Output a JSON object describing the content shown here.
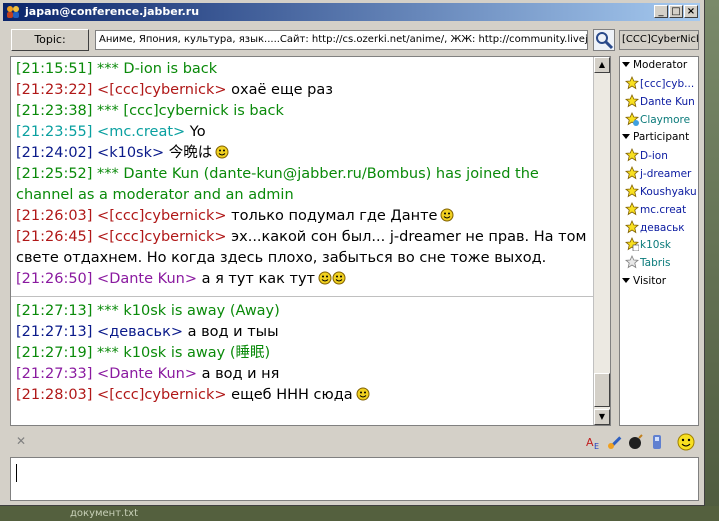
{
  "window": {
    "title": "japan@conference.jabber.ru"
  },
  "topic": {
    "button_label": "Topic:",
    "text": "Аниме, Япония, культура, язык.....Сайт: http://cs.ozerki.net/anime/, ЖЖ: http://community.livejournal"
  },
  "my_nick": "[CCC]CyberNick",
  "colors": {
    "green": "#0a8a0a",
    "red": "#b01818",
    "blue": "#0a1a8a",
    "teal": "#0aa0a0",
    "purple": "#8a1aa0",
    "accent": "#0a246a"
  },
  "messages": [
    {
      "ts": "[21:15:51]",
      "nick": "",
      "text": "*** D-ion is back",
      "color": "green"
    },
    {
      "ts": "[21:23:22]",
      "nick": "<[ccc]cybernick>",
      "text": "охаё еще раз",
      "color": "red"
    },
    {
      "ts": "[21:23:38]",
      "nick": "",
      "text": "*** [ccc]cybernick is back",
      "color": "green"
    },
    {
      "ts": "[21:23:55]",
      "nick": "<mc.creat>",
      "text": "Yo",
      "color": "teal"
    },
    {
      "ts": "[21:24:02]",
      "nick": "<k10sk>",
      "text": "今晩は",
      "color": "blue",
      "smiley": true
    },
    {
      "ts": "[21:25:52]",
      "nick": "",
      "text": "*** Dante Kun (dante-kun@jabber.ru/Bombus) has joined the channel as a moderator and an admin",
      "color": "green",
      "wrap": true
    },
    {
      "ts": "[21:26:03]",
      "nick": "<[ccc]cybernick>",
      "text": "только подумал где Данте",
      "color": "red",
      "smiley": true
    },
    {
      "ts": "[21:26:45]",
      "nick": "<[ccc]cybernick>",
      "text": "эх...какой сон был... j-dreamer не прав. На том свете отдахнем. Но когда здесь плохо, забыться во сне тоже выход.",
      "color": "red",
      "wrap": true
    },
    {
      "ts": "[21:26:50]",
      "nick": "<Dante Kun>",
      "text": "а я тут как тут",
      "color": "purple",
      "smiley2": true
    },
    {
      "ts": "[21:27:13]",
      "nick": "",
      "text": "*** k10sk is away (Away)",
      "color": "green",
      "sep": true
    },
    {
      "ts": "[21:27:13]",
      "nick": "<деваськ>",
      "text": "а вод и тыы",
      "color": "blue"
    },
    {
      "ts": "[21:27:19]",
      "nick": "",
      "text": "*** k10sk is away (睡眠)",
      "color": "green"
    },
    {
      "ts": "[21:27:33]",
      "nick": "<Dante Kun>",
      "text": "а вод и ня",
      "color": "purple"
    },
    {
      "ts": "[21:28:03]",
      "nick": "<[ccc]cybernick>",
      "text": "ещеб ННН сюда",
      "color": "red",
      "smiley": true
    }
  ],
  "roster": {
    "groups": [
      {
        "label": "Moderator",
        "members": [
          {
            "name": "[ccc]cyb...",
            "icon": "star-online-icon",
            "color": "#0a1aa0"
          },
          {
            "name": "Dante Kun",
            "icon": "star-online-icon",
            "color": "#0a1aa0"
          },
          {
            "name": "Claymore",
            "icon": "star-away-icon",
            "color": "#0a7a7a"
          }
        ]
      },
      {
        "label": "Participant",
        "members": [
          {
            "name": "D-ion",
            "icon": "star-online-icon",
            "color": "#0a1aa0"
          },
          {
            "name": "j-dreamer",
            "icon": "star-online-icon",
            "color": "#0a1aa0"
          },
          {
            "name": "Koushyaku",
            "icon": "star-online-icon",
            "color": "#0a1aa0"
          },
          {
            "name": "mc.creat",
            "icon": "star-online-icon",
            "color": "#0a1aa0"
          },
          {
            "name": "деваськ",
            "icon": "star-online-icon",
            "color": "#0a1aa0"
          },
          {
            "name": "k10sk",
            "icon": "star-zzz-icon",
            "color": "#0a7a7a"
          },
          {
            "name": "Tabris",
            "icon": "star-offline-icon",
            "color": "#0a7a7a"
          }
        ]
      },
      {
        "label": "Visitor",
        "members": []
      }
    ]
  },
  "desktop": {
    "caption": "документ.txt"
  }
}
